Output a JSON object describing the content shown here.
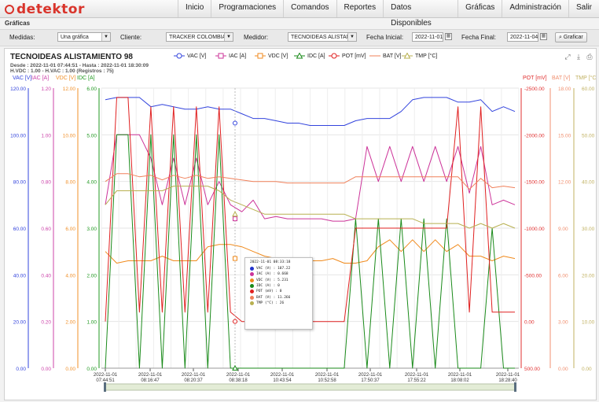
{
  "app": {
    "logo": "detektor"
  },
  "nav": [
    "Inicio",
    "Programaciones",
    "Comandos",
    "Reportes",
    "Datos Disponibles",
    "Gráficas",
    "Administración",
    "Salir"
  ],
  "breadcrumb": "Gráficas",
  "filters": {
    "medidas_label": "Medidas:",
    "medidas_value": "Una gráfica",
    "cliente_label": "Cliente:",
    "cliente_value": "TRACKER COLOMBIA",
    "medidor_label": "Medidor:",
    "medidor_value": "TECNOIDEAS ALISTAMIE",
    "fecha_inicial_label": "Fecha Inicial:",
    "fecha_inicial_value": "2022-11-01",
    "fecha_final_label": "Fecha Final:",
    "fecha_final_value": "2022-11-04",
    "button": "Graficar"
  },
  "chart": {
    "title": "TECNOIDEAS ALISTAMIENTO 98",
    "subtitle1": "Desde : 2022-11-01 07:44:51 - Hasta : 2022-11-01 18:30:09",
    "subtitle2": "H.VDC : 1.00 - H.VAC : 1.00 (Registros : 75)"
  },
  "tooltip": {
    "header": "2022-11-01 08:33:18",
    "rows": [
      {
        "text": "VAC (V) : 107.22",
        "color": "#2233cc"
      },
      {
        "text": "IAC (A) : 0.668",
        "color": "#cc3399"
      },
      {
        "text": "VDC (V) : 5.231",
        "color": "#f08a1c"
      },
      {
        "text": "IDC (A) : 0",
        "color": "#1a8a1a"
      },
      {
        "text": "POT (mV) : 0",
        "color": "#e02020"
      },
      {
        "text": "BAT (V) : 11.266",
        "color": "#f0805a"
      },
      {
        "text": "TMP (°C) : 26",
        "color": "#b8b050"
      }
    ]
  },
  "icons": [
    "fullscreen-icon",
    "download-icon",
    "print-icon"
  ],
  "chart_data": {
    "type": "line",
    "x_ticks": [
      [
        "2022-11-01",
        "07:44:51"
      ],
      [
        "2022-11-01",
        "08:16:47"
      ],
      [
        "2022-11-01",
        "08:20:37"
      ],
      [
        "2022-11-01",
        "08:38:18"
      ],
      [
        "2022-11-01",
        "10:43:54"
      ],
      [
        "2022-11-01",
        "10:52:58"
      ],
      [
        "2022-11-01",
        "17:50:37"
      ],
      [
        "2022-11-01",
        "17:55:22"
      ],
      [
        "2022-11-01",
        "18:08:02"
      ],
      [
        "2022-11-01",
        "18:28:40"
      ]
    ],
    "left_axes": [
      {
        "name": "VAC [V]",
        "color": "#3344dd",
        "ticks": [
          "120.00",
          "100.00",
          "80.00",
          "60.00",
          "40.00",
          "20.00",
          "0.00"
        ]
      },
      {
        "name": "IAC [A]",
        "color": "#cc44aa",
        "ticks": [
          "1.20",
          "1.00",
          "0.80",
          "0.60",
          "0.40",
          "0.20",
          "0.00"
        ]
      },
      {
        "name": "VDC [V]",
        "color": "#f0902a",
        "ticks": [
          "12.00",
          "10.00",
          "8.00",
          "6.00",
          "4.00",
          "2.00",
          "0.00"
        ]
      },
      {
        "name": "IDC [A]",
        "color": "#229922",
        "ticks": [
          "6.00",
          "5.00",
          "4.00",
          "3.00",
          "2.00",
          "1.00",
          "0.00"
        ]
      }
    ],
    "right_axes": [
      {
        "name": "POT [mV]",
        "color": "#e03030",
        "ticks": [
          "-2500.00",
          "-2000.00",
          "-1500.00",
          "-1000.00",
          "-500.00",
          "0.00",
          "500.00"
        ]
      },
      {
        "name": "BAT [V]",
        "color": "#f09070",
        "ticks": [
          "18.00",
          "15.00",
          "12.00",
          "9.00",
          "6.00",
          "3.00",
          "0.00"
        ]
      },
      {
        "name": "TMP [°C]",
        "color": "#c0b060",
        "ticks": [
          "60.00",
          "50.00",
          "40.00",
          "30.00",
          "20.00",
          "10.00",
          "0.00"
        ]
      }
    ],
    "series": [
      {
        "name": "VAC [V]",
        "color": "#3344dd",
        "marker": "circle",
        "values": [
          115,
          116,
          116,
          116,
          112,
          113,
          112,
          111,
          111,
          112,
          111,
          111,
          109,
          107,
          107,
          106,
          105,
          105,
          104,
          104,
          104,
          104,
          106,
          107,
          107,
          107,
          110,
          115,
          116,
          116,
          116,
          114,
          114,
          115,
          110,
          112,
          110
        ]
      },
      {
        "name": "IAC [A]",
        "color": "#cc3399",
        "marker": "square",
        "values": [
          0.7,
          1.0,
          1.0,
          1.0,
          0.9,
          0.7,
          0.9,
          0.7,
          0.9,
          0.7,
          0.8,
          0.7,
          0.67,
          0.72,
          0.64,
          0.65,
          0.64,
          0.64,
          0.64,
          0.64,
          0.63,
          0.63,
          0.64,
          0.95,
          0.8,
          0.95,
          0.8,
          0.95,
          0.8,
          0.95,
          0.8,
          0.95,
          0.75,
          0.95,
          0.7,
          0.72,
          0.7
        ]
      },
      {
        "name": "VDC [V]",
        "color": "#f08a1c",
        "marker": "square",
        "values": [
          5.0,
          4.5,
          4.6,
          4.6,
          4.6,
          4.8,
          4.6,
          4.6,
          4.6,
          5.2,
          5.3,
          5.3,
          5.2,
          5.0,
          4.8,
          4.7,
          4.7,
          4.7,
          4.6,
          4.6,
          4.7,
          4.5,
          4.5,
          4.6,
          5.2,
          5.5,
          5.0,
          5.5,
          5.0,
          5.5,
          5.0,
          5.3,
          4.8,
          4.8,
          4.6,
          4.8,
          4.7
        ]
      },
      {
        "name": "IDC [A]",
        "color": "#1a8a1a",
        "marker": "triangle",
        "values": [
          0,
          5.0,
          5.0,
          0,
          5.0,
          0,
          5.0,
          0,
          5.0,
          0,
          5.0,
          0,
          0,
          0,
          0,
          0,
          0,
          0,
          0,
          0,
          0,
          0,
          3.2,
          0,
          3.2,
          0,
          3.2,
          0,
          3.2,
          0,
          3.2,
          0,
          0,
          0,
          3.0,
          0,
          0
        ]
      },
      {
        "name": "POT [mV]",
        "color": "#e02020",
        "marker": "circle",
        "values": [
          0,
          -2400,
          -2400,
          -100,
          -2300,
          -100,
          -2300,
          -100,
          -2300,
          -100,
          -2300,
          -100,
          0,
          0,
          0,
          0,
          0,
          0,
          0,
          0,
          0,
          0,
          -1000,
          -1000,
          -1000,
          -1000,
          -1000,
          -1000,
          -1000,
          -1000,
          -1000,
          -2300,
          -100,
          -2300,
          -100,
          -100,
          -100
        ]
      },
      {
        "name": "BAT [V]",
        "color": "#f0805a",
        "marker": "line",
        "values": [
          12.0,
          12.5,
          12.5,
          12.3,
          12.4,
          12.1,
          12.4,
          12.2,
          12.4,
          12.2,
          12.3,
          12.2,
          12.1,
          12.0,
          12.0,
          12.0,
          11.9,
          11.9,
          11.9,
          11.9,
          11.9,
          11.9,
          12.3,
          12.3,
          12.3,
          12.3,
          12.3,
          12.3,
          12.3,
          12.3,
          12.3,
          12.3,
          11.5,
          12.2,
          11.6,
          11.7,
          11.6
        ]
      },
      {
        "name": "TMP [°C]",
        "color": "#b8b050",
        "marker": "triangle",
        "values": [
          35,
          38,
          38,
          38,
          38,
          38,
          39,
          39,
          39,
          39,
          38,
          36,
          35,
          34,
          33,
          33,
          33,
          33,
          33,
          33,
          33,
          33,
          32,
          32,
          32,
          32,
          32,
          32,
          31,
          31,
          31,
          31,
          30,
          31,
          30,
          31,
          30
        ]
      }
    ]
  }
}
